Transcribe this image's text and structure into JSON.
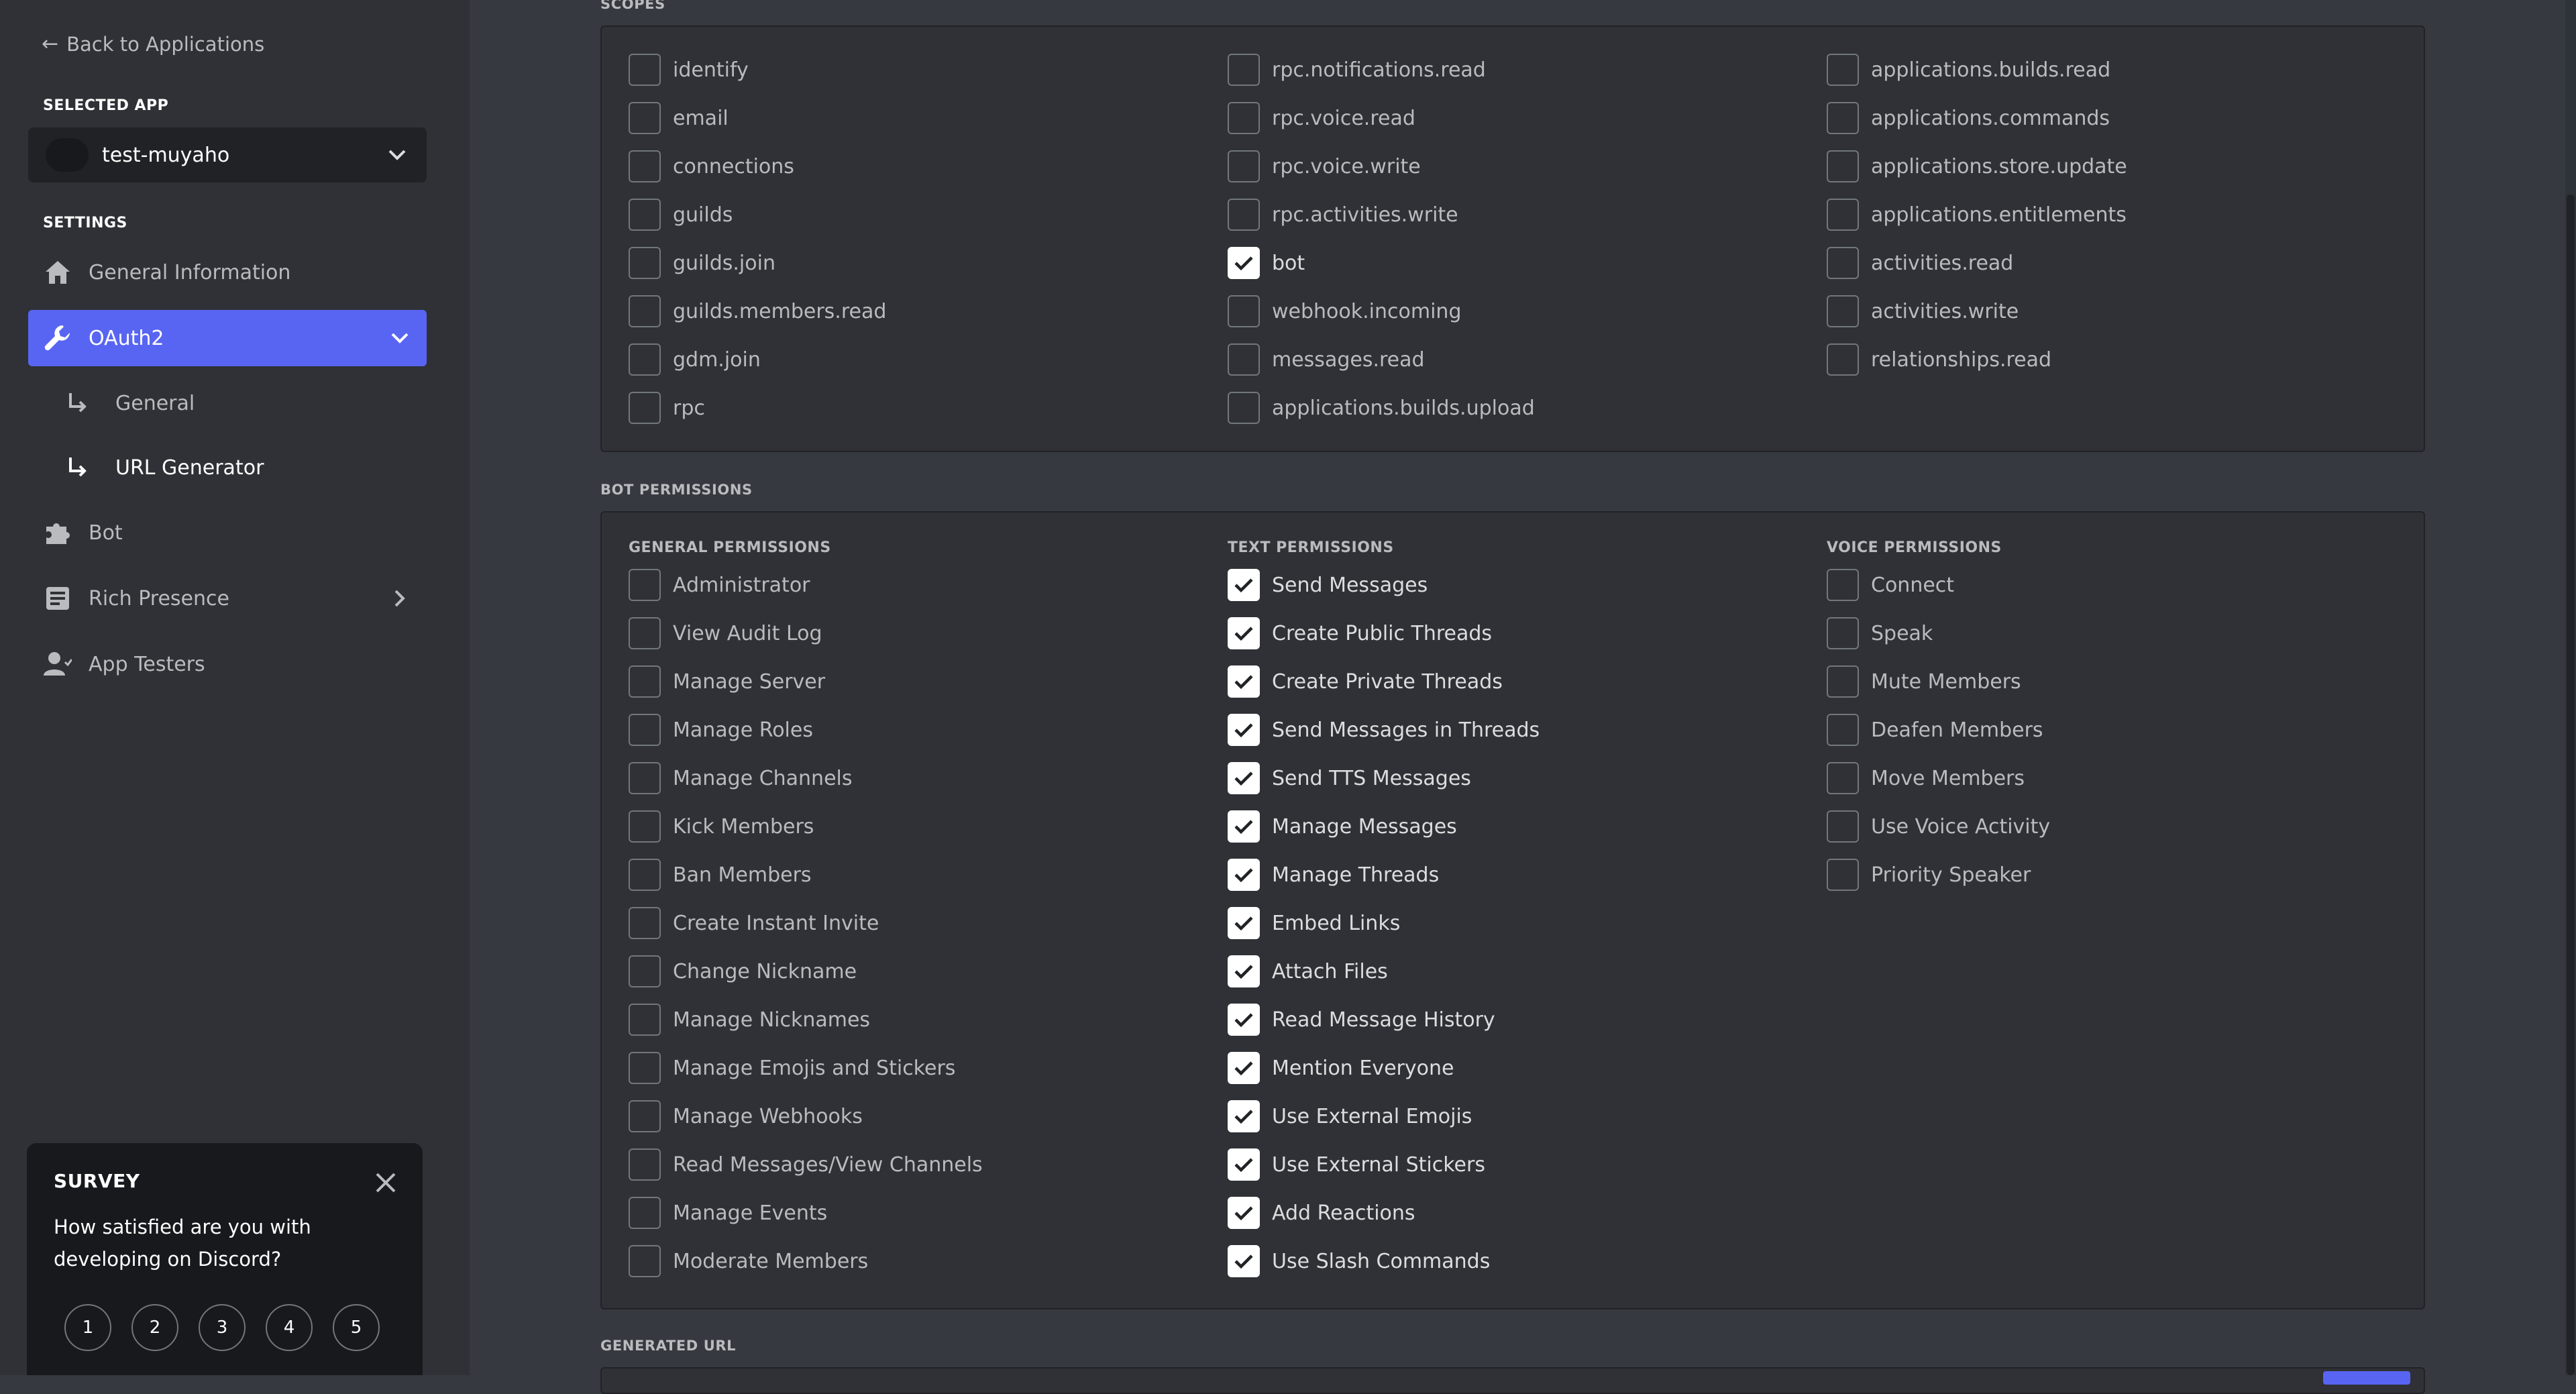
{
  "sidebar": {
    "back_label": "Back to Applications",
    "selected_app_heading": "Selected App",
    "app_name": "test-muyaho",
    "settings_heading": "Settings",
    "nav": {
      "general_information": "General Information",
      "oauth2": "OAuth2",
      "oauth2_general": "General",
      "url_generator": "URL Generator",
      "bot": "Bot",
      "rich_presence": "Rich Presence",
      "app_testers": "App Testers"
    }
  },
  "survey": {
    "title": "SURVEY",
    "question": "How satisfied are you with developing on Discord?",
    "options": [
      "1",
      "2",
      "3",
      "4",
      "5"
    ]
  },
  "scopes": {
    "heading": "Scopes",
    "columns": [
      [
        {
          "label": "identify",
          "checked": false
        },
        {
          "label": "email",
          "checked": false
        },
        {
          "label": "connections",
          "checked": false
        },
        {
          "label": "guilds",
          "checked": false
        },
        {
          "label": "guilds.join",
          "checked": false
        },
        {
          "label": "guilds.members.read",
          "checked": false
        },
        {
          "label": "gdm.join",
          "checked": false
        },
        {
          "label": "rpc",
          "checked": false
        }
      ],
      [
        {
          "label": "rpc.notifications.read",
          "checked": false
        },
        {
          "label": "rpc.voice.read",
          "checked": false
        },
        {
          "label": "rpc.voice.write",
          "checked": false
        },
        {
          "label": "rpc.activities.write",
          "checked": false
        },
        {
          "label": "bot",
          "checked": true
        },
        {
          "label": "webhook.incoming",
          "checked": false
        },
        {
          "label": "messages.read",
          "checked": false
        },
        {
          "label": "applications.builds.upload",
          "checked": false
        }
      ],
      [
        {
          "label": "applications.builds.read",
          "checked": false
        },
        {
          "label": "applications.commands",
          "checked": false
        },
        {
          "label": "applications.store.update",
          "checked": false
        },
        {
          "label": "applications.entitlements",
          "checked": false
        },
        {
          "label": "activities.read",
          "checked": false
        },
        {
          "label": "activities.write",
          "checked": false
        },
        {
          "label": "relationships.read",
          "checked": false
        }
      ]
    ]
  },
  "bot_permissions": {
    "heading": "Bot Permissions",
    "columns": [
      {
        "heading": "General Permissions",
        "items": [
          {
            "label": "Administrator",
            "checked": false
          },
          {
            "label": "View Audit Log",
            "checked": false
          },
          {
            "label": "Manage Server",
            "checked": false
          },
          {
            "label": "Manage Roles",
            "checked": false
          },
          {
            "label": "Manage Channels",
            "checked": false
          },
          {
            "label": "Kick Members",
            "checked": false
          },
          {
            "label": "Ban Members",
            "checked": false
          },
          {
            "label": "Create Instant Invite",
            "checked": false
          },
          {
            "label": "Change Nickname",
            "checked": false
          },
          {
            "label": "Manage Nicknames",
            "checked": false
          },
          {
            "label": "Manage Emojis and Stickers",
            "checked": false
          },
          {
            "label": "Manage Webhooks",
            "checked": false
          },
          {
            "label": "Read Messages/View Channels",
            "checked": false
          },
          {
            "label": "Manage Events",
            "checked": false
          },
          {
            "label": "Moderate Members",
            "checked": false
          }
        ]
      },
      {
        "heading": "Text Permissions",
        "items": [
          {
            "label": "Send Messages",
            "checked": true
          },
          {
            "label": "Create Public Threads",
            "checked": true
          },
          {
            "label": "Create Private Threads",
            "checked": true
          },
          {
            "label": "Send Messages in Threads",
            "checked": true
          },
          {
            "label": "Send TTS Messages",
            "checked": true
          },
          {
            "label": "Manage Messages",
            "checked": true
          },
          {
            "label": "Manage Threads",
            "checked": true
          },
          {
            "label": "Embed Links",
            "checked": true
          },
          {
            "label": "Attach Files",
            "checked": true
          },
          {
            "label": "Read Message History",
            "checked": true
          },
          {
            "label": "Mention Everyone",
            "checked": true
          },
          {
            "label": "Use External Emojis",
            "checked": true
          },
          {
            "label": "Use External Stickers",
            "checked": true
          },
          {
            "label": "Add Reactions",
            "checked": true
          },
          {
            "label": "Use Slash Commands",
            "checked": true
          }
        ]
      },
      {
        "heading": "Voice Permissions",
        "items": [
          {
            "label": "Connect",
            "checked": false
          },
          {
            "label": "Speak",
            "checked": false
          },
          {
            "label": "Mute Members",
            "checked": false
          },
          {
            "label": "Deafen Members",
            "checked": false
          },
          {
            "label": "Move Members",
            "checked": false
          },
          {
            "label": "Use Voice Activity",
            "checked": false
          },
          {
            "label": "Priority Speaker",
            "checked": false
          }
        ]
      }
    ]
  },
  "generated_url": {
    "heading": "Generated URL"
  },
  "colors": {
    "accent": "#5865f2",
    "background": "#36393f",
    "sidebar": "#2f3136"
  }
}
